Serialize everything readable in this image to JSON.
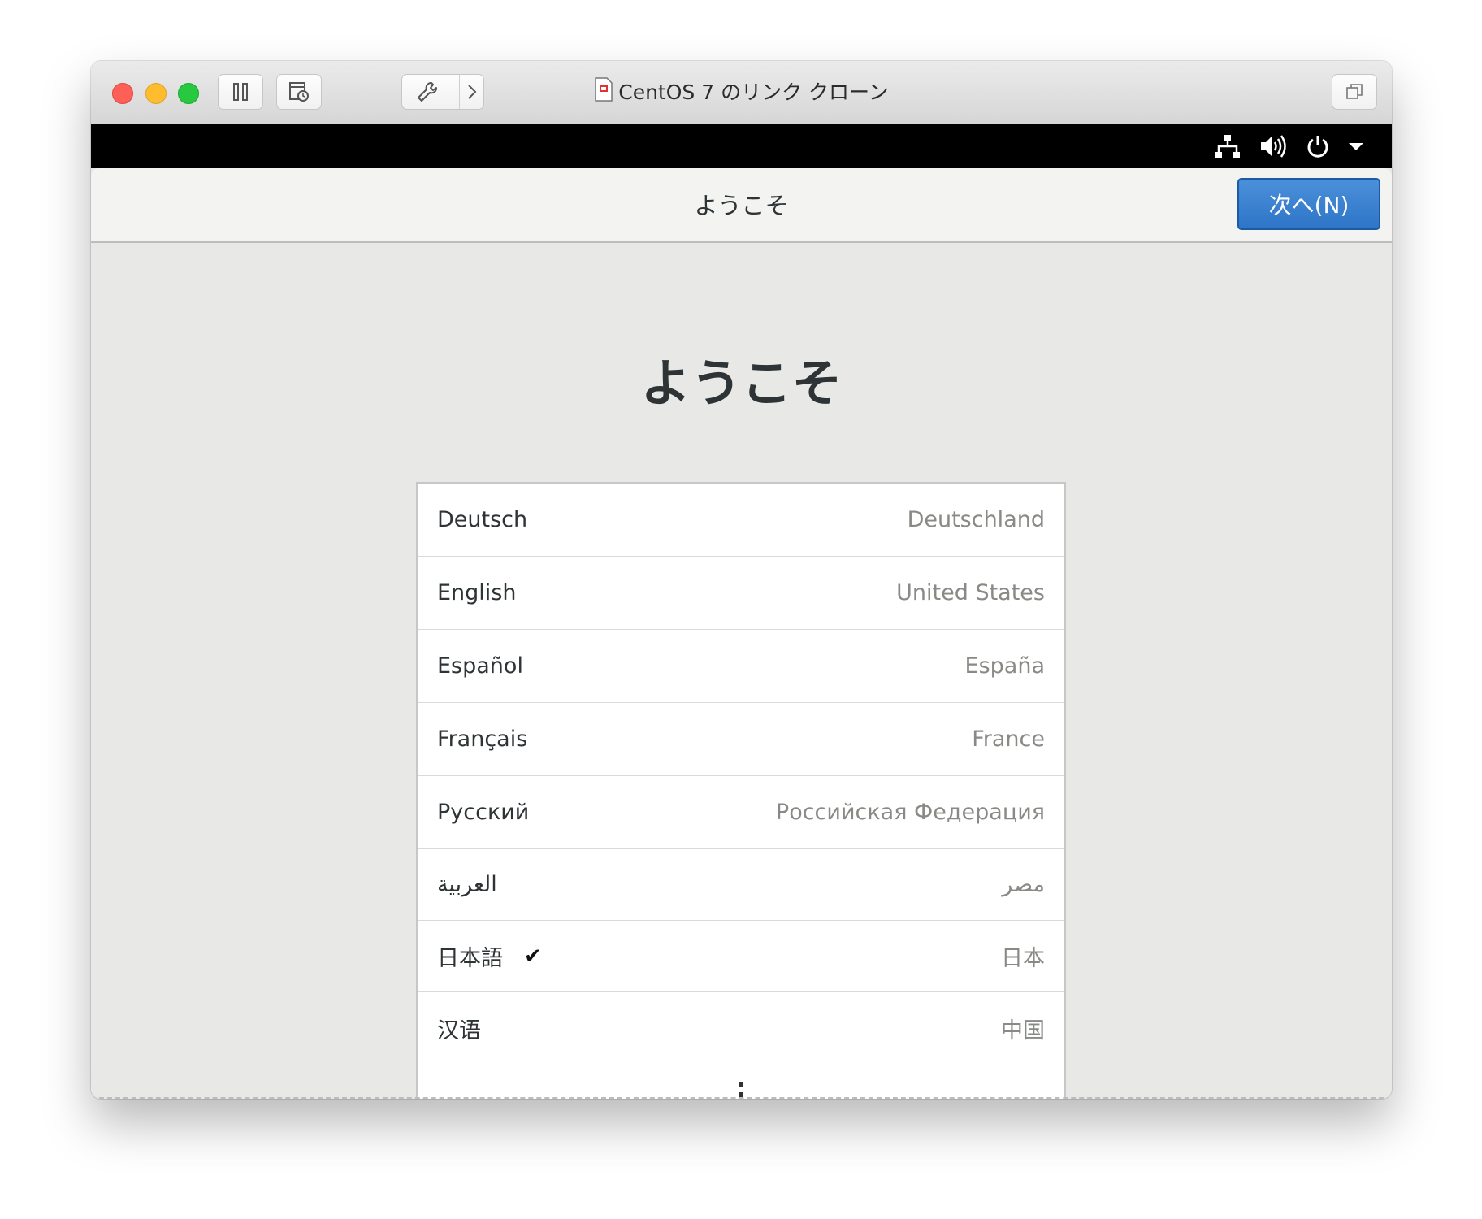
{
  "window": {
    "title": "CentOS 7 のリンク クローン",
    "toolbar_icons": [
      "pause-icon",
      "snapshot-icon",
      "wrench-icon",
      "chevron-right-icon",
      "restore-window-icon"
    ]
  },
  "guest_topbar": {
    "icons": [
      "network-icon",
      "volume-icon",
      "power-icon",
      "dropdown-arrow-icon"
    ]
  },
  "installer": {
    "header_title": "ようこそ",
    "next_button": "次へ(N)",
    "welcome_heading": "ようこそ",
    "languages": [
      {
        "name": "Deutsch",
        "region": "Deutschland",
        "selected": false
      },
      {
        "name": "English",
        "region": "United States",
        "selected": false
      },
      {
        "name": "Español",
        "region": "España",
        "selected": false
      },
      {
        "name": "Français",
        "region": "France",
        "selected": false
      },
      {
        "name": "Русский",
        "region": "Российская Федерация",
        "selected": false
      },
      {
        "name": "العربية",
        "region": "مصر",
        "selected": false
      },
      {
        "name": "日本語",
        "region": "日本",
        "selected": true
      },
      {
        "name": "汉语",
        "region": "中国",
        "selected": false
      }
    ],
    "more_icon": "vertical-ellipsis-icon"
  },
  "colors": {
    "accent_blue": "#3584e4",
    "close_red": "#fe5f57",
    "minimize_yellow": "#febc2e",
    "zoom_green": "#28c840"
  }
}
